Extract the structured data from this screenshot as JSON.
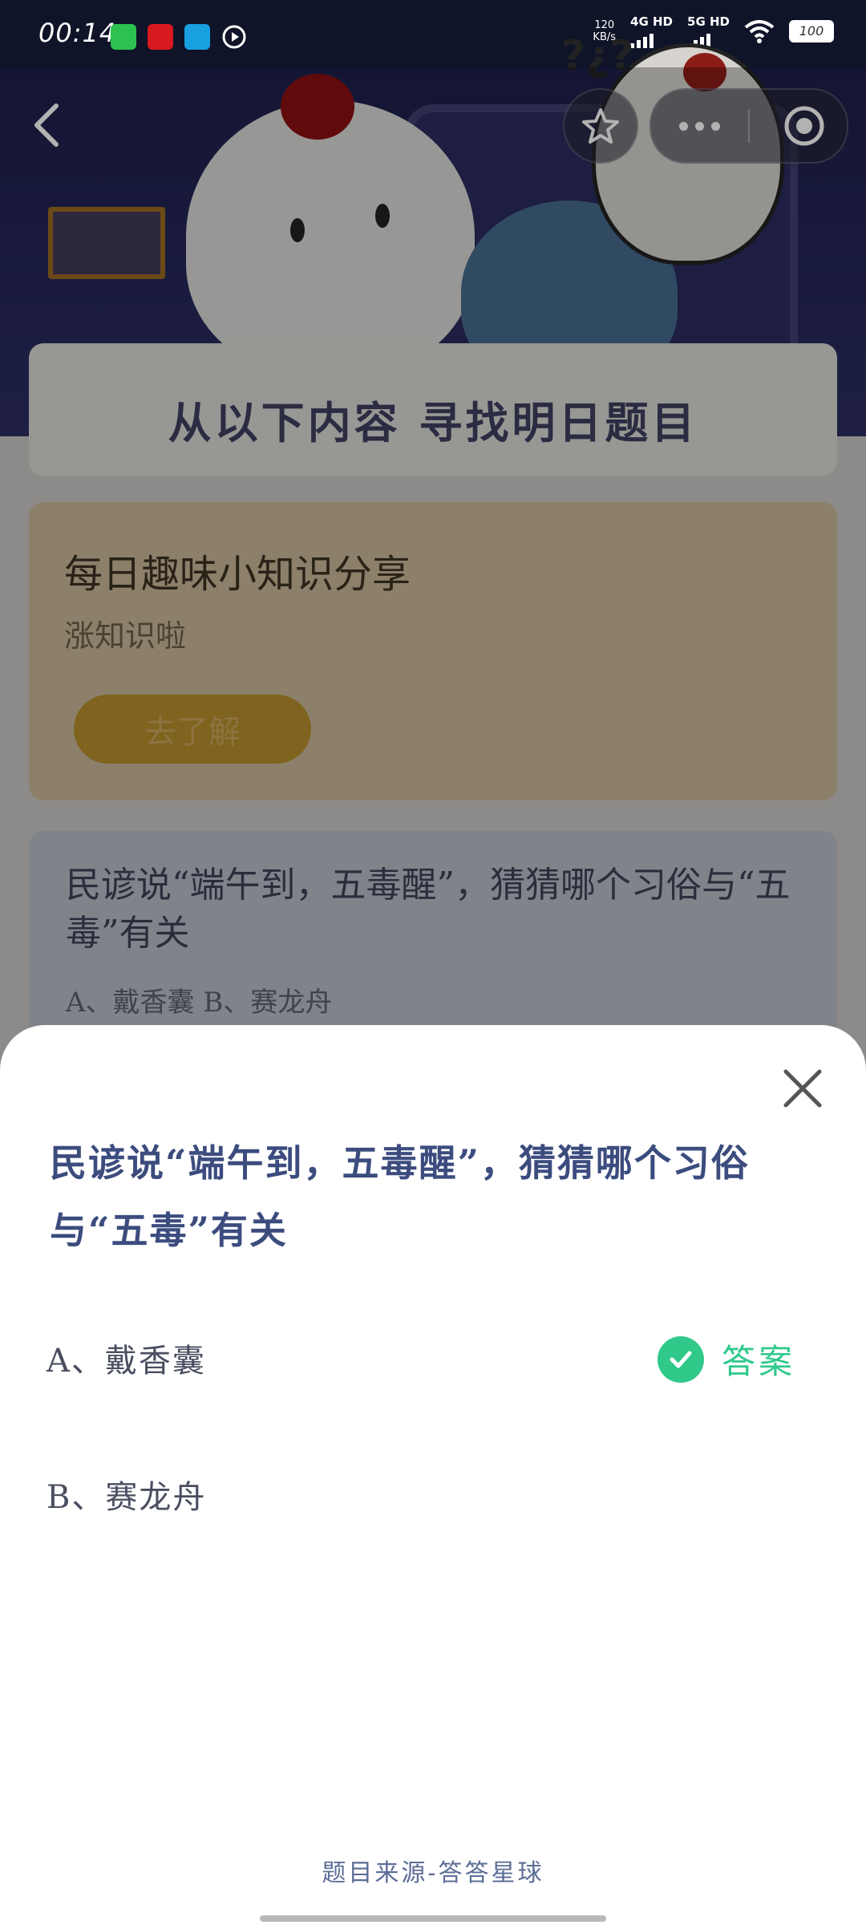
{
  "status_bar": {
    "time": "00:14",
    "speed_value": "120",
    "speed_unit": "KB/s",
    "net1": "4G HD",
    "net2": "5G HD",
    "battery": "100"
  },
  "background": {
    "title": "从以下内容 寻找明日题目",
    "share_card": {
      "title": "每日趣味小知识分享",
      "subtitle": "涨知识啦",
      "button": "去了解"
    },
    "question_card": {
      "question": "民谚说“端午到，五毒醒”，猜猜哪个习俗与“五毒”有关",
      "options": "A、戴香囊    B、赛龙舟"
    }
  },
  "sheet": {
    "question": "民谚说“端午到，五毒醒”，猜猜哪个习俗与“五毒”有关",
    "options": [
      {
        "label": "A、戴香囊",
        "is_answer": true
      },
      {
        "label": "B、赛龙舟",
        "is_answer": false
      }
    ],
    "answer_label": "答案",
    "source": "题目来源-答答星球"
  },
  "colors": {
    "accent_green": "#30c98a",
    "question_blue": "#3c4c7e"
  }
}
